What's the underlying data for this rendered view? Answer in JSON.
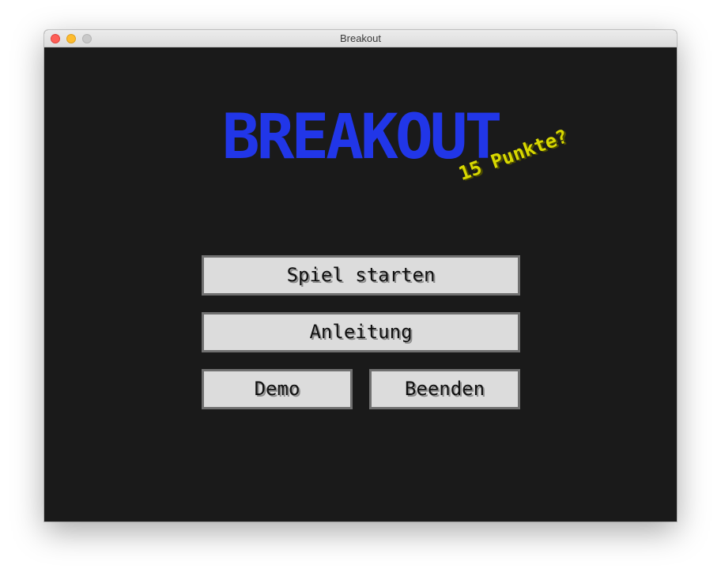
{
  "window": {
    "title": "Breakout"
  },
  "menu": {
    "logo": "BREAKOUT",
    "subtitle": "15 Punkte?",
    "buttons": {
      "start": "Spiel starten",
      "help": "Anleitung",
      "demo": "Demo",
      "quit": "Beenden"
    }
  },
  "colors": {
    "background": "#1a1a1a",
    "logo": "#2136e8",
    "subtitle": "#d8d800",
    "button_face": "#dcdcdc",
    "button_border": "#707070"
  }
}
